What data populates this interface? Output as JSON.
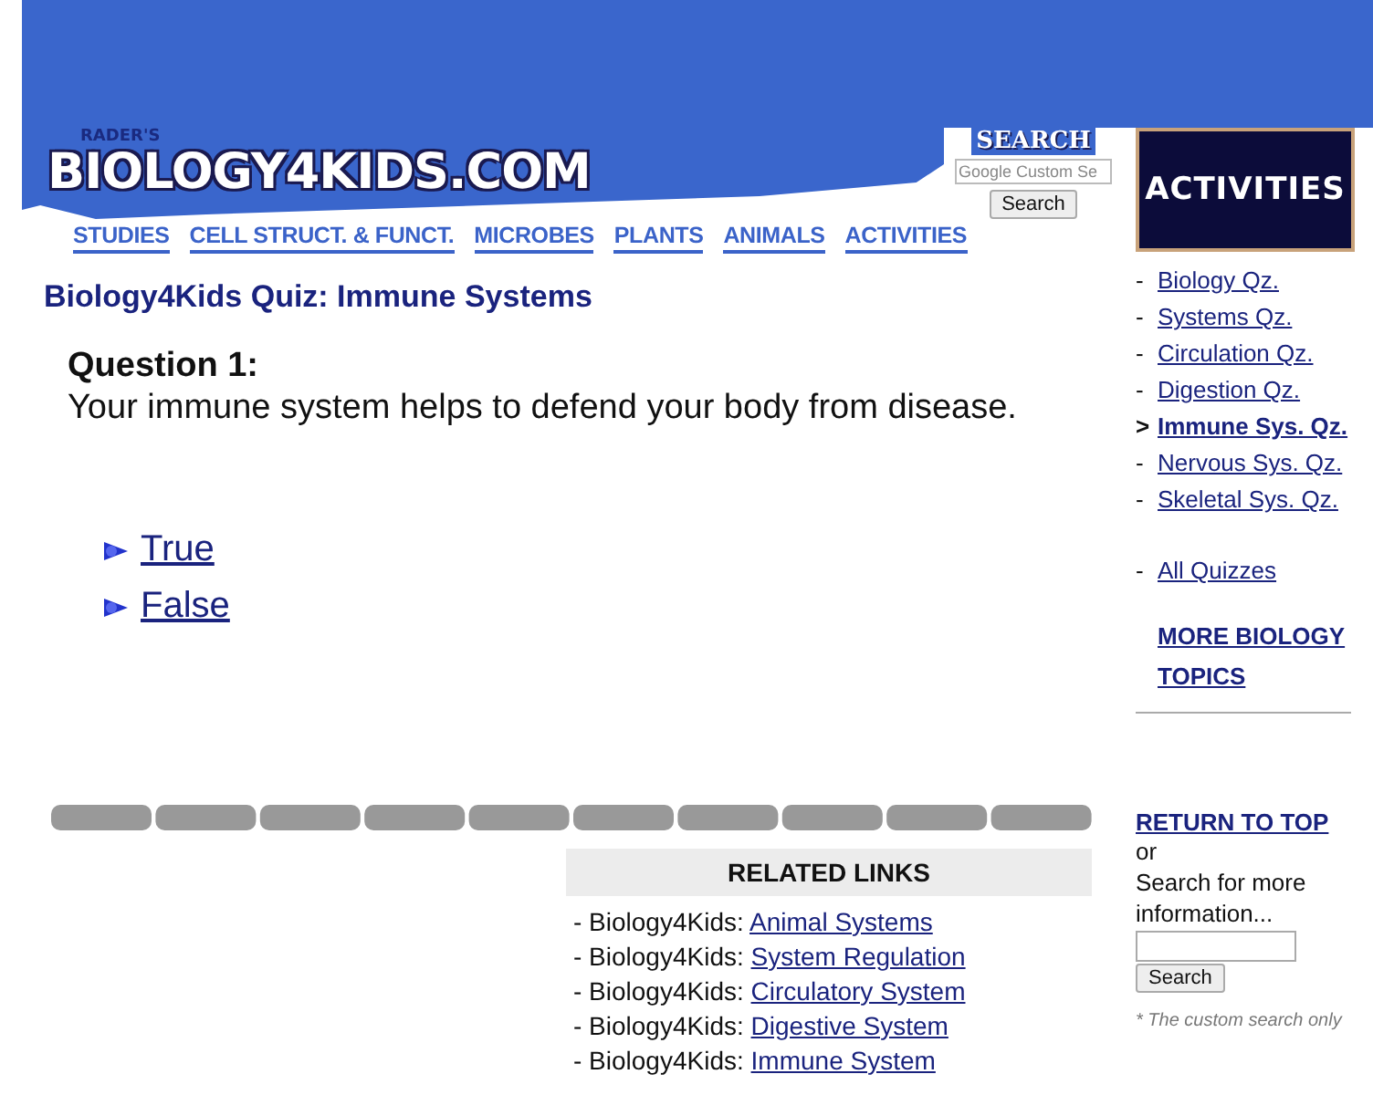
{
  "header": {
    "logo_small": "RADER'S",
    "logo": "BIOLOGY4KIDS.COM",
    "search_label": "SEARCH",
    "search_placeholder": "Google Custom Se",
    "search_button": "Search"
  },
  "nav": [
    {
      "label": "STUDIES"
    },
    {
      "label": "CELL STRUCT. & FUNCT."
    },
    {
      "label": "MICROBES"
    },
    {
      "label": "PLANTS"
    },
    {
      "label": "ANIMALS"
    },
    {
      "label": "ACTIVITIES"
    }
  ],
  "quiz": {
    "title": "Biology4Kids Quiz: Immune Systems",
    "question_label": "Question 1:",
    "question": "Your immune system helps to defend your body from disease.",
    "answers": [
      {
        "label": "True"
      },
      {
        "label": "False"
      }
    ]
  },
  "related_links": {
    "title": "RELATED LINKS",
    "items": [
      {
        "prefix": "- Biology4Kids:",
        "link": "Animal Systems"
      },
      {
        "prefix": "- Biology4Kids:",
        "link": "System Regulation"
      },
      {
        "prefix": "- Biology4Kids:",
        "link": "Circulatory System"
      },
      {
        "prefix": "- Biology4Kids:",
        "link": "Digestive System"
      },
      {
        "prefix": "- Biology4Kids:",
        "link": "Immune System"
      }
    ]
  },
  "sidebar": {
    "banner": "ACTIVITIES",
    "quizzes": [
      {
        "marker": "-",
        "label": "Biology Qz.",
        "selected": false
      },
      {
        "marker": "-",
        "label": "Systems Qz.",
        "selected": false
      },
      {
        "marker": "-",
        "label": "Circulation Qz.",
        "selected": false
      },
      {
        "marker": "-",
        "label": "Digestion Qz.",
        "selected": false
      },
      {
        "marker": ">",
        "label": "Immune Sys. Qz.",
        "selected": true
      },
      {
        "marker": "-",
        "label": "Nervous Sys. Qz.",
        "selected": false
      },
      {
        "marker": "-",
        "label": "Skeletal Sys. Qz.",
        "selected": false
      }
    ],
    "all_quizzes": {
      "marker": "-",
      "label": "All Quizzes"
    },
    "more_topics": "MORE BIOLOGY TOPICS",
    "return_top": "RETURN TO TOP",
    "or": "or",
    "search_hint": "Search for more information...",
    "search_button": "Search",
    "footnote": "* The custom search only"
  }
}
